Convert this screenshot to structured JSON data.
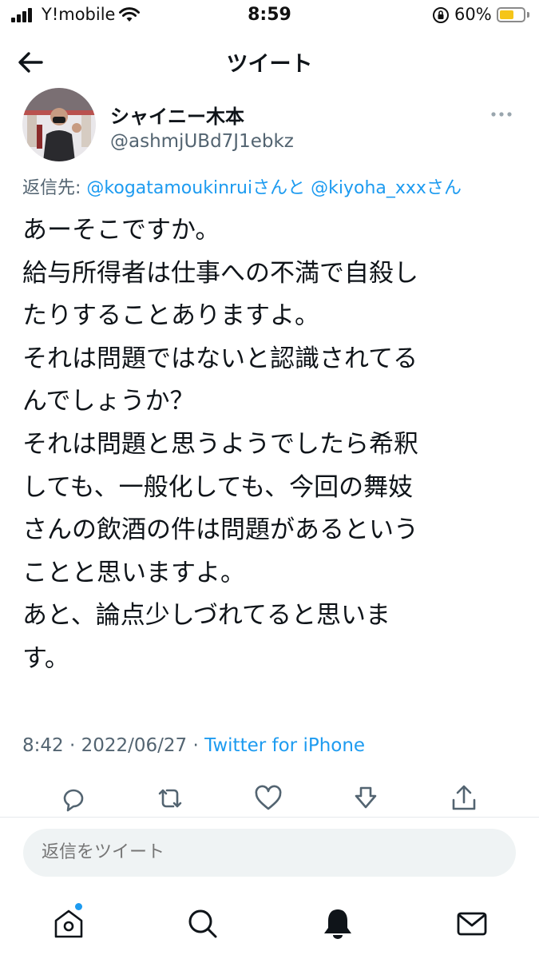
{
  "status_bar": {
    "carrier": "Y!mobile",
    "time": "8:59",
    "battery_percent": "60%",
    "battery_level": 0.6
  },
  "header": {
    "title": "ツイート"
  },
  "author": {
    "display_name": "シャイニー木本",
    "handle": "@ashmjUBd7J1ebkz"
  },
  "reply_to": {
    "prefix": "返信先: ",
    "user1": "@kogatamoukinrui",
    "joiner": "さんと",
    "user2": "@kiyoha_xxx",
    "suffix": "さん"
  },
  "tweet": {
    "lines": [
      "あーそこですか。",
      "給与所得者は仕事への不満で自殺し",
      "たりすることありますよ。",
      "それは問題ではないと認識されてる",
      "んでしょうか？",
      "それは問題と思うようでしたら希釈",
      "しても、一般化しても、今回の舞妓",
      "さんの飲酒の件は問題があるという",
      "ことと思いますよ。",
      "あと、論点少しづれてると思いま",
      "す。"
    ]
  },
  "meta": {
    "time": "8:42",
    "separator": " · ",
    "date": "2022/06/27",
    "source": "Twitter for iPhone"
  },
  "reply_box": {
    "placeholder": "返信をツイート"
  },
  "colors": {
    "accent": "#1d9bf0",
    "text": "#0f1419",
    "muted": "#536471",
    "battery": "#f5c518"
  },
  "icons": {
    "actions": [
      "reply-icon",
      "retweet-icon",
      "like-icon",
      "download-icon",
      "share-icon"
    ],
    "tabs": [
      "home-icon",
      "search-icon",
      "notifications-icon",
      "messages-icon"
    ]
  }
}
